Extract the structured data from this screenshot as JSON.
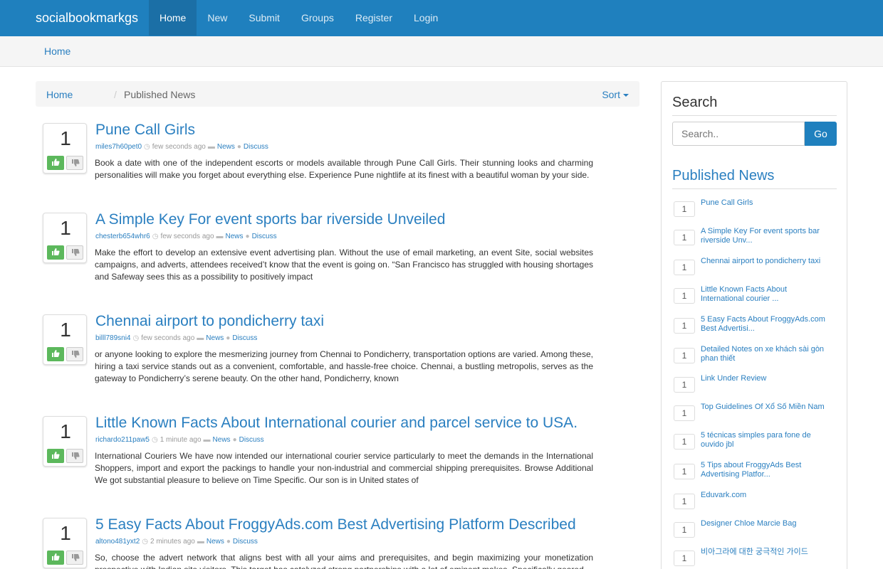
{
  "navbar": {
    "brand": "socialbookmarkgs",
    "items": [
      {
        "label": "Home",
        "active": true
      },
      {
        "label": "New"
      },
      {
        "label": "Submit"
      },
      {
        "label": "Groups"
      },
      {
        "label": "Register"
      },
      {
        "label": "Login"
      }
    ]
  },
  "topbar": {
    "home": "Home"
  },
  "breadcrumb": {
    "home": "Home",
    "separator": "/",
    "current": "Published News",
    "sort": "Sort"
  },
  "posts": [
    {
      "votes": "1",
      "title": "Pune Call Girls",
      "author": "miles7h60pet0",
      "time": "few seconds ago",
      "category": "News",
      "discuss": "Discuss",
      "excerpt": "Book a date with one of the independent escorts or models available through Pune Call Girls. Their stunning looks and charming personalities will make you forget about everything else. Experience Pune nightlife at its finest with a beautiful woman by your side."
    },
    {
      "votes": "1",
      "title": "A Simple Key For event sports bar riverside Unveiled",
      "author": "chesterb654whr6",
      "time": "few seconds ago",
      "category": "News",
      "discuss": "Discuss",
      "excerpt": "Make the effort to develop an extensive event advertising plan. Without the use of email marketing, an event Site, social websites campaigns, and adverts, attendees received’t know that the event is going on. “San Francisco has struggled with housing shortages and Safeway sees this as a possibility to positively impact"
    },
    {
      "votes": "1",
      "title": "Chennai airport to pondicherry taxi",
      "author": "billl789sni4",
      "time": "few seconds ago",
      "category": "News",
      "discuss": "Discuss",
      "excerpt": "or anyone looking to explore the mesmerizing journey from Chennai to Pondicherry, transportation options are varied. Among these, hiring a taxi service stands out as a convenient, comfortable, and hassle-free choice. Chennai, a bustling metropolis, serves as the gateway to Pondicherry’s serene beauty. On the other hand, Pondicherry, known"
    },
    {
      "votes": "1",
      "title": "Little Known Facts About International courier and parcel service to USA.",
      "author": "richardo211paw5",
      "time": "1 minute ago",
      "category": "News",
      "discuss": "Discuss",
      "excerpt": "International Couriers We have now intended our international courier service particularly to meet the demands in the International Shoppers, import and export the packings to handle your non-industrial and commercial shipping prerequisites. Browse Additional We got substantial pleasure to believe on Time Specific. Our son is in United states of"
    },
    {
      "votes": "1",
      "title": "5 Easy Facts About FroggyAds.com Best Advertising Platform Described",
      "author": "altono481yxt2",
      "time": "2 minutes ago",
      "category": "News",
      "discuss": "Discuss",
      "excerpt": "So, choose the advert network that aligns best with all your aims and prerequisites, and begin maximizing your monetization prospective with Indian site visitors. This target has catalyzed strong partnerships with a lot of eminent makes. Specifically geared"
    }
  ],
  "sidebar": {
    "search_title": "Search",
    "search_placeholder": "Search..",
    "go_label": "Go",
    "published_title": "Published News",
    "items": [
      {
        "count": "1",
        "label": "Pune Call Girls"
      },
      {
        "count": "1",
        "label": "A Simple Key For event sports bar riverside Unv..."
      },
      {
        "count": "1",
        "label": "Chennai airport to pondicherry taxi"
      },
      {
        "count": "1",
        "label": "Little Known Facts About International courier ..."
      },
      {
        "count": "1",
        "label": "5 Easy Facts About FroggyAds.com Best Advertisi..."
      },
      {
        "count": "1",
        "label": "Detailed Notes on xe khách sài gòn phan thiết"
      },
      {
        "count": "1",
        "label": "Link Under Review"
      },
      {
        "count": "1",
        "label": "Top Guidelines Of Xổ Số Miền Nam"
      },
      {
        "count": "1",
        "label": "5 técnicas simples para fone de ouvido jbl"
      },
      {
        "count": "1",
        "label": "5 Tips about FroggyAds Best Advertising Platfor..."
      },
      {
        "count": "1",
        "label": "Eduvark.com"
      },
      {
        "count": "1",
        "label": "Designer Chloe Marcie Bag"
      },
      {
        "count": "1",
        "label": "비아그라에 대한 궁극적인 가이드"
      }
    ]
  },
  "colors": {
    "navbar": "#1f80be",
    "link": "#2a7fc0",
    "upvote": "#5cb85c"
  }
}
